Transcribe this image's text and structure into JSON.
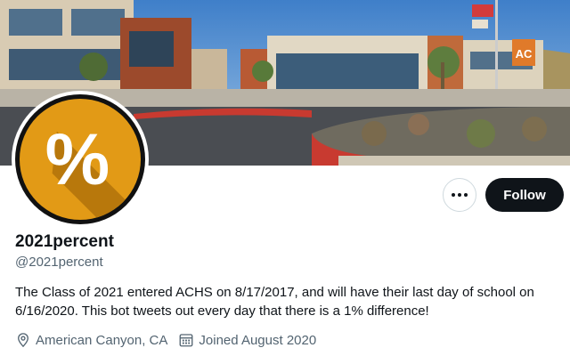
{
  "profile": {
    "display_name": "2021percent",
    "handle": "@2021percent",
    "bio": "The Class of 2021 entered ACHS on 8/17/2017, and will have their last day of school on 6/16/2020. This bot tweets out every day that there is a 1% difference!",
    "location": "American Canyon, CA",
    "joined": "Joined August 2020",
    "avatar_symbol": "%",
    "avatar_color": "#e29a16"
  },
  "actions": {
    "follow_label": "Follow"
  },
  "banner": {
    "building_sign": "AC"
  },
  "icons": {
    "more": "more-icon",
    "location": "location-pin-icon",
    "joined": "calendar-icon"
  },
  "colors": {
    "follow_bg": "#0f1419",
    "secondary_text": "#536471",
    "border": "#cfd9de"
  }
}
